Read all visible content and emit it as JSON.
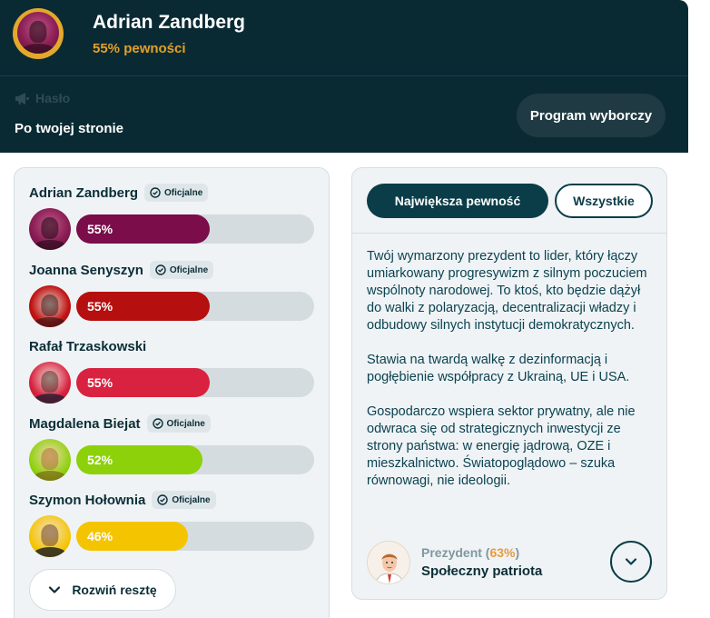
{
  "header": {
    "name": "Adrian Zandberg",
    "confidence": "55% pewności",
    "slogan_label": "Hasło",
    "slogan": "Po twojej stronie",
    "program_button": "Program wyborczy",
    "accent_color": "#e3a02a",
    "background_color": "#0a2a33"
  },
  "candidates": [
    {
      "name": "Adrian Zandberg",
      "official": true,
      "badge": "Oficjalne",
      "percent_label": "55%",
      "percent": 55,
      "color": "#7a0d4a"
    },
    {
      "name": "Joanna Senyszyn",
      "official": true,
      "badge": "Oficjalne",
      "percent_label": "55%",
      "percent": 55,
      "color": "#b60f0f"
    },
    {
      "name": "Rafał Trzaskowski",
      "official": false,
      "badge": "",
      "percent_label": "55%",
      "percent": 55,
      "color": "#d8223f"
    },
    {
      "name": "Magdalena Biejat",
      "official": true,
      "badge": "Oficjalne",
      "percent_label": "52%",
      "percent": 52,
      "color": "#8cd10a"
    },
    {
      "name": "Szymon Hołownia",
      "official": true,
      "badge": "Oficjalne",
      "percent_label": "46%",
      "percent": 46,
      "color": "#f5c400"
    }
  ],
  "expand_button": "Rozwiń resztę",
  "tabs": [
    {
      "label": "Największa pewność",
      "active": true
    },
    {
      "label": "Wszystkie",
      "active": false
    }
  ],
  "description": [
    "Twój wymarzony prezydent to lider, który łączy umiarkowany progresywizm z silnym poczuciem wspólnoty narodowej. To ktoś, kto będzie dążył do walki z polaryzacją, decentralizacji władzy i odbudowy silnych instytucji demokratycznych.",
    "Stawia na twardą walkę z dezinformacją i pogłębienie współpracy z Ukrainą, UE i USA.",
    "Gospodarczo wspiera sektor prywatny, ale nie odwraca się od strategicznych inwestycji ze strony państwa: w energię jądrową, OZE i mieszkalnictwo. Światopoglądowo – szuka równowagi, nie ideologii."
  ],
  "president": {
    "label": "Prezydent",
    "percent": "63%",
    "type": "Społeczny patriota"
  },
  "icons": {
    "slogan": "megaphone-icon",
    "badge": "check-badge-icon",
    "expand": "chevron-down-icon",
    "more": "chevron-down-icon"
  }
}
